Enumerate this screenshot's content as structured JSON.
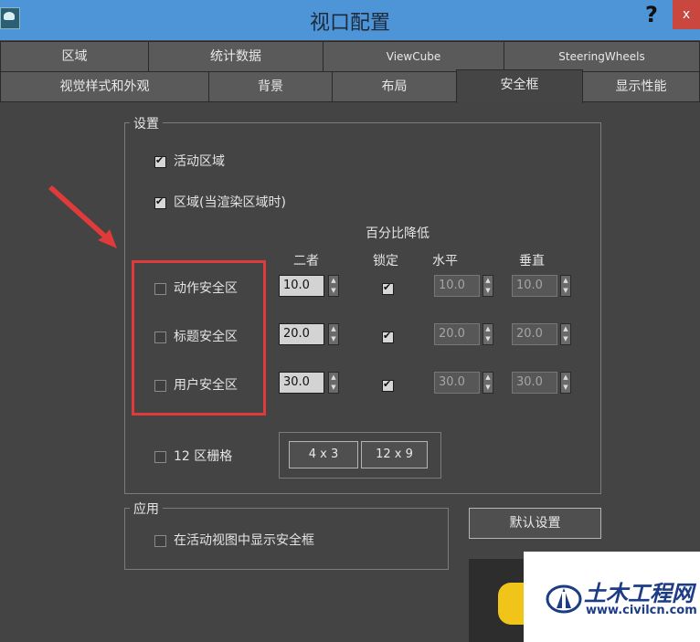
{
  "window": {
    "title": "视口配置",
    "help": "?",
    "close": "x"
  },
  "tabs_row1": [
    "区域",
    "统计数据",
    "ViewCube",
    "SteeringWheels"
  ],
  "tabs_row2": [
    "视觉样式和外观",
    "背景",
    "布局",
    "安全框",
    "显示性能"
  ],
  "active_tab": "安全框",
  "settings": {
    "legend": "设置",
    "live_area": {
      "label": "活动区域",
      "checked": true
    },
    "region_when_render": {
      "label": "区域(当渲染区域时)",
      "checked": true
    },
    "percent_reduce": "百分比降低",
    "col_both": "二者",
    "col_lock": "锁定",
    "col_horizontal": "水平",
    "col_vertical": "垂直",
    "zones": [
      {
        "label": "动作安全区",
        "both": "10.0",
        "horizontal": "10.0",
        "vertical": "10.0"
      },
      {
        "label": "标题安全区",
        "both": "20.0",
        "horizontal": "20.0",
        "vertical": "20.0"
      },
      {
        "label": "用户安全区",
        "both": "30.0",
        "horizontal": "30.0",
        "vertical": "30.0"
      }
    ],
    "grid12": {
      "label": "12 区栅格",
      "btn1": "4 x 3",
      "btn2": "12 x 9"
    }
  },
  "apply": {
    "legend": "应用",
    "show_in_active": "在活动视图中显示安全框",
    "default_button": "默认设置"
  },
  "watermark": {
    "title": "土木工程网",
    "url": "www.civilcn.com"
  },
  "colors": {
    "highlight": "#e03a3a",
    "titlebar": "#4e95d8"
  }
}
